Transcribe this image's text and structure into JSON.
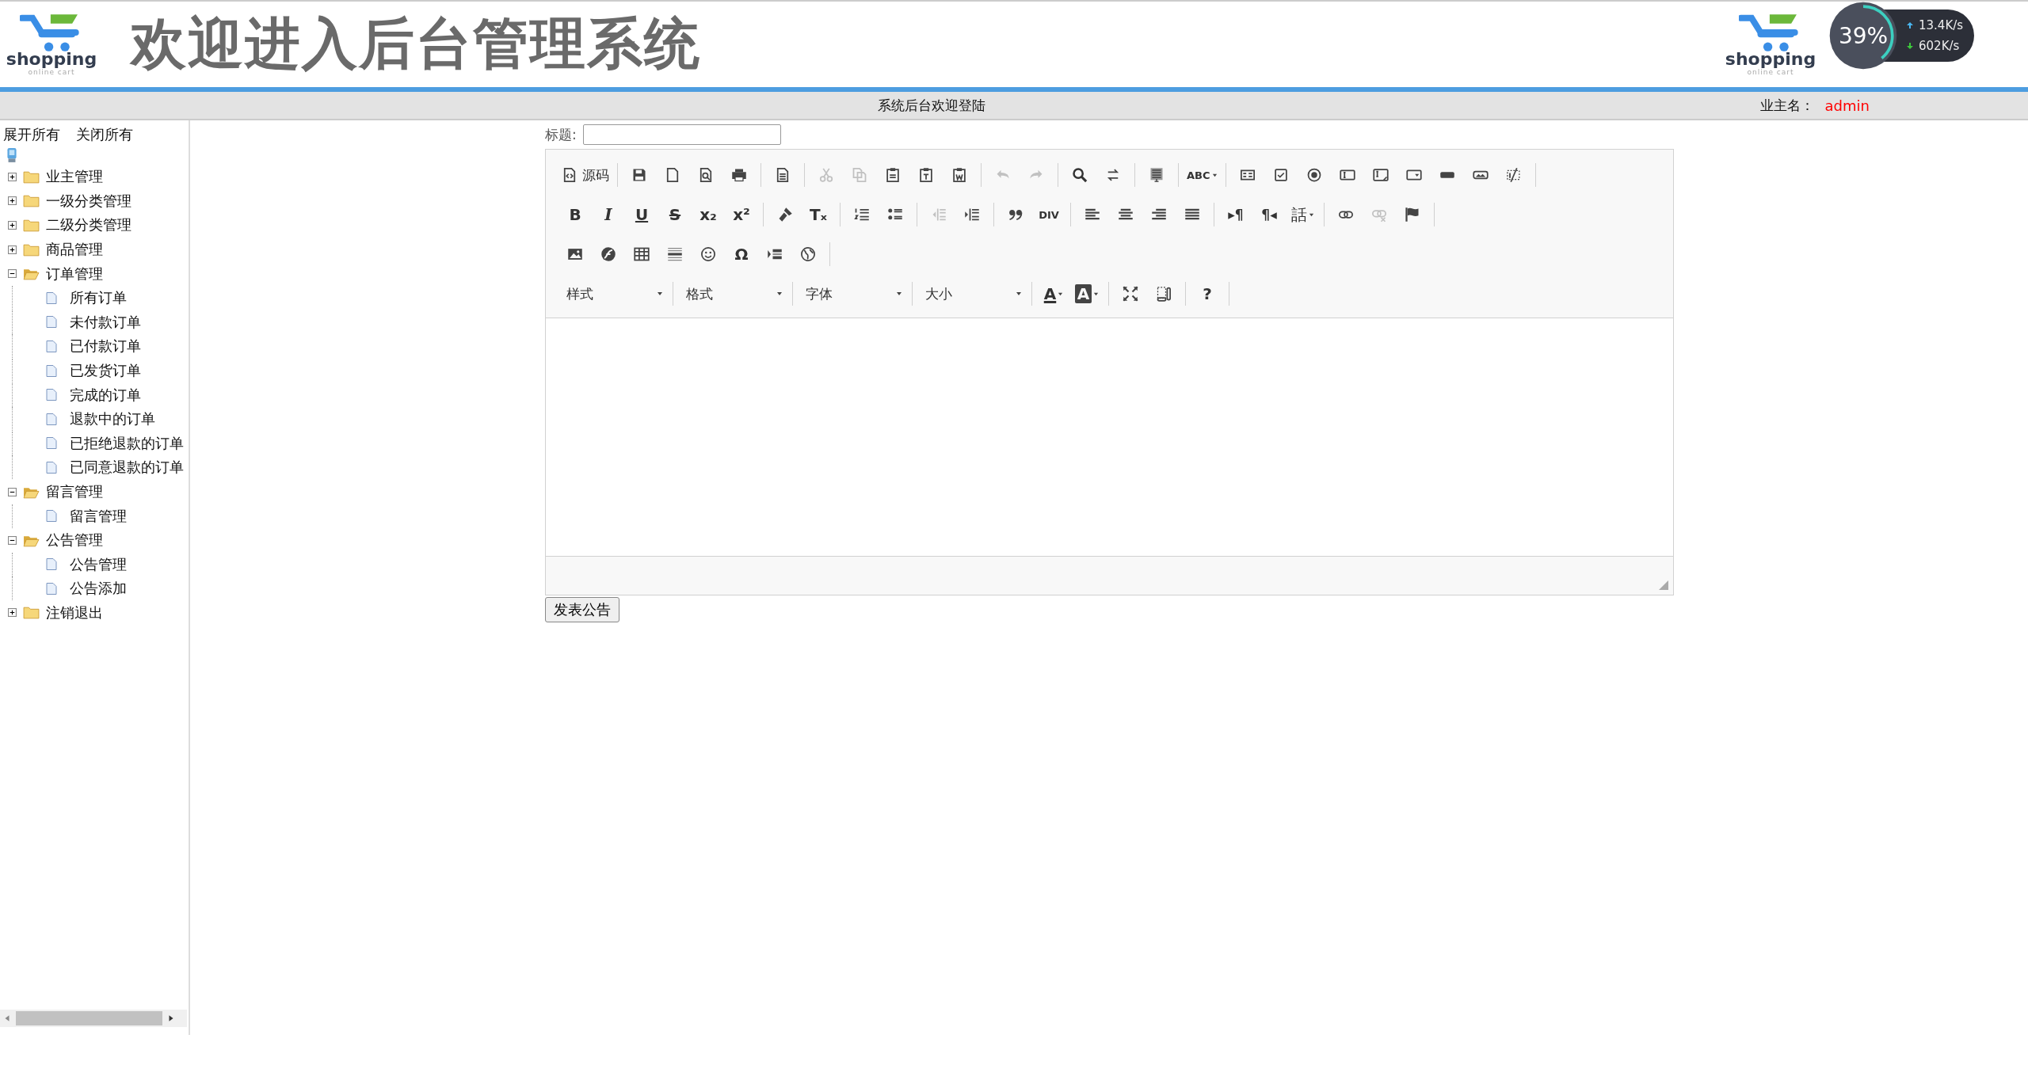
{
  "header": {
    "logo": {
      "name": "shopping",
      "tagline": "online cart"
    },
    "title": "欢迎进入后台管理系统",
    "repeat_logo": {
      "name": "shopping",
      "tagline": "online cart"
    }
  },
  "network_monitor": {
    "usage": "39%",
    "level": 0.39,
    "upload": "13.4K/s",
    "download": "602K/s"
  },
  "info_bar": {
    "message": "系统后台欢迎登陆",
    "user_label": "业主名：",
    "user": "admin"
  },
  "sidebar": {
    "expand_all": "展开所有",
    "collapse_all": "关闭所有",
    "tree": [
      {
        "label": "业主管理",
        "expanded": false
      },
      {
        "label": "一级分类管理",
        "expanded": false
      },
      {
        "label": "二级分类管理",
        "expanded": false
      },
      {
        "label": "商品管理",
        "expanded": false
      },
      {
        "label": "订单管理",
        "expanded": true,
        "children": [
          {
            "label": "所有订单"
          },
          {
            "label": "未付款订单"
          },
          {
            "label": "已付款订单"
          },
          {
            "label": "已发货订单"
          },
          {
            "label": "完成的订单"
          },
          {
            "label": "退款中的订单"
          },
          {
            "label": "已拒绝退款的订单"
          },
          {
            "label": "已同意退款的订单"
          }
        ]
      },
      {
        "label": "留言管理",
        "expanded": true,
        "children": [
          {
            "label": "留言管理"
          }
        ]
      },
      {
        "label": "公告管理",
        "expanded": true,
        "children": [
          {
            "label": "公告管理"
          },
          {
            "label": "公告添加"
          }
        ]
      },
      {
        "label": "注销退出",
        "expanded": false
      }
    ]
  },
  "form": {
    "title_label": "标题:",
    "submit_button": "发表公告"
  },
  "editor": {
    "toolbar": [
      {
        "groups": [
          [
            {
              "kind": "source",
              "label": "源码",
              "disabled": false
            }
          ],
          [
            {
              "kind": "save",
              "disabled": false
            },
            {
              "kind": "newpage",
              "disabled": false
            },
            {
              "kind": "preview",
              "disabled": false
            },
            {
              "kind": "print",
              "disabled": false
            }
          ],
          [
            {
              "kind": "templates",
              "disabled": false
            }
          ],
          [
            {
              "kind": "cut",
              "disabled": true
            },
            {
              "kind": "copy",
              "disabled": true
            },
            {
              "kind": "paste",
              "disabled": false
            },
            {
              "kind": "pastetext",
              "disabled": false
            },
            {
              "kind": "pasteword",
              "disabled": false
            }
          ],
          [
            {
              "kind": "undo",
              "disabled": true
            },
            {
              "kind": "redo",
              "disabled": true
            }
          ],
          [
            {
              "kind": "find",
              "disabled": false
            },
            {
              "kind": "replace",
              "disabled": false
            }
          ],
          [
            {
              "kind": "selectall",
              "disabled": false
            }
          ],
          [
            {
              "kind": "spellcheck",
              "glyph": "ABC",
              "menu": true,
              "disabled": false
            }
          ],
          [
            {
              "kind": "form",
              "disabled": false
            },
            {
              "kind": "checkbox",
              "disabled": false
            },
            {
              "kind": "radio",
              "disabled": false
            },
            {
              "kind": "textfield",
              "disabled": false
            },
            {
              "kind": "textarea",
              "disabled": false
            },
            {
              "kind": "select",
              "disabled": false
            },
            {
              "kind": "button",
              "disabled": false
            },
            {
              "kind": "imagebutton",
              "disabled": false
            },
            {
              "kind": "hiddenfield",
              "disabled": false
            }
          ]
        ]
      },
      {
        "groups": [
          [
            {
              "kind": "bold",
              "glyph": "B",
              "disabled": false
            },
            {
              "kind": "italic",
              "glyph": "I",
              "disabled": false
            },
            {
              "kind": "underline",
              "glyph": "U",
              "disabled": false
            },
            {
              "kind": "strike",
              "glyph": "S",
              "disabled": false
            },
            {
              "kind": "subscript",
              "glyph": "x₂",
              "disabled": false
            },
            {
              "kind": "superscript",
              "glyph": "x²",
              "disabled": false
            }
          ],
          [
            {
              "kind": "copyformat",
              "disabled": false
            },
            {
              "kind": "removeformat",
              "glyph": "Tₓ",
              "disabled": false
            }
          ],
          [
            {
              "kind": "numberedlist",
              "disabled": false
            },
            {
              "kind": "bulletedlist",
              "disabled": false
            }
          ],
          [
            {
              "kind": "outdent",
              "disabled": true
            },
            {
              "kind": "indent",
              "disabled": false
            }
          ],
          [
            {
              "kind": "blockquote",
              "disabled": false
            },
            {
              "kind": "creatediv",
              "glyph": "DIV",
              "disabled": false
            }
          ],
          [
            {
              "kind": "alignleft",
              "disabled": false
            },
            {
              "kind": "aligncenter",
              "disabled": false
            },
            {
              "kind": "alignright",
              "disabled": false
            },
            {
              "kind": "alignjustify",
              "disabled": false
            }
          ],
          [
            {
              "kind": "ltr",
              "glyph": "▸¶",
              "disabled": false
            },
            {
              "kind": "rtl",
              "glyph": "¶◂",
              "disabled": false
            },
            {
              "kind": "language",
              "glyph": "話",
              "menu": true,
              "disabled": false
            }
          ],
          [
            {
              "kind": "link",
              "disabled": false
            },
            {
              "kind": "unlink",
              "disabled": true
            },
            {
              "kind": "anchor",
              "disabled": false
            }
          ]
        ]
      },
      {
        "groups": [
          [
            {
              "kind": "image",
              "disabled": false
            },
            {
              "kind": "flash",
              "disabled": false
            },
            {
              "kind": "table",
              "disabled": false
            },
            {
              "kind": "hline",
              "disabled": false
            },
            {
              "kind": "smiley",
              "disabled": false
            },
            {
              "kind": "specialchar",
              "glyph": "Ω",
              "disabled": false
            },
            {
              "kind": "pagebreak",
              "disabled": false
            },
            {
              "kind": "iframe",
              "disabled": false
            }
          ]
        ]
      },
      {
        "groups": [
          [
            {
              "kind": "combo",
              "label": "样式",
              "disabled": false
            }
          ],
          [
            {
              "kind": "combo",
              "label": "格式",
              "disabled": false
            }
          ],
          [
            {
              "kind": "combo",
              "label": "字体",
              "disabled": false
            }
          ],
          [
            {
              "kind": "combo",
              "label": "大小",
              "disabled": false
            }
          ],
          [
            {
              "kind": "textcolor",
              "glyph": "A",
              "menu": true,
              "disabled": false
            },
            {
              "kind": "bgcolor",
              "glyph": "A",
              "menu": true,
              "disabled": false
            }
          ],
          [
            {
              "kind": "maximize",
              "disabled": false
            },
            {
              "kind": "showblocks",
              "disabled": false
            }
          ],
          [
            {
              "kind": "about",
              "glyph": "?",
              "disabled": false
            }
          ]
        ]
      }
    ]
  }
}
